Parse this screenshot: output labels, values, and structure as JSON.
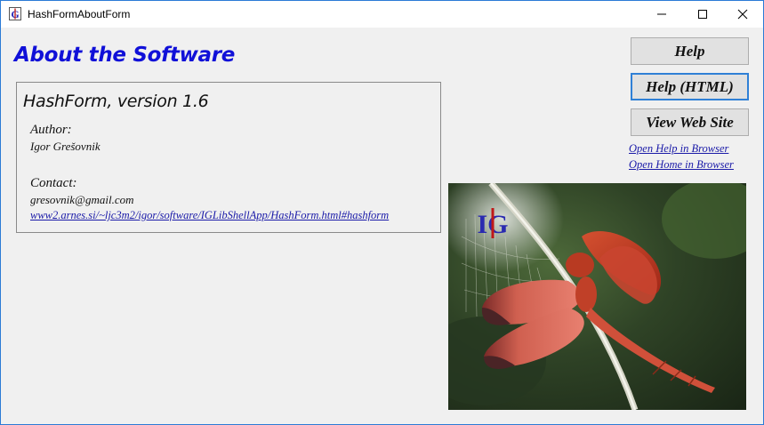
{
  "window": {
    "title": "HashFormAboutForm"
  },
  "heading": "About the Software",
  "info": {
    "product": "HashForm, version 1.6",
    "author_label": "Author:",
    "author": "Igor Grešovnik",
    "contact_label": "Contact:",
    "email": "gresovnik@gmail.com",
    "url": "www2.arnes.si/~ljc3m2/igor/software/IGLibShellApp/HashForm.html#hashform"
  },
  "buttons": {
    "help": "Help",
    "help_html": "Help (HTML)",
    "web_site": "View Web Site"
  },
  "links": {
    "open_help": "Open Help in Browser",
    "open_home": "Open Home in Browser"
  },
  "image": {
    "logo_text": "IG"
  },
  "colors": {
    "heading": "#1010d8",
    "link": "#1a1aa8",
    "focus_border": "#2f80d6"
  }
}
